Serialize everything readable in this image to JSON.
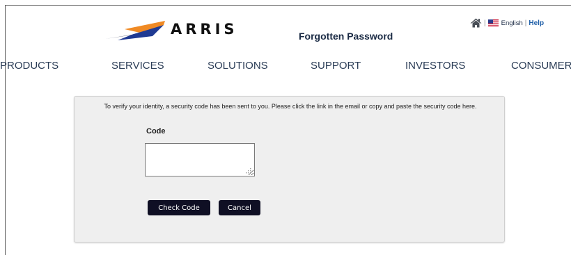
{
  "header": {
    "logo_text": "ARRIS",
    "page_title": "Forgotten Password",
    "language": "English",
    "separator": "|",
    "help_label": "Help"
  },
  "nav": {
    "items": [
      {
        "label": "PRODUCTS"
      },
      {
        "label": "SERVICES"
      },
      {
        "label": "SOLUTIONS"
      },
      {
        "label": "SUPPORT"
      },
      {
        "label": "INVESTORS"
      },
      {
        "label": "CONSUMERS"
      }
    ]
  },
  "form": {
    "instructions": "To verify your identity, a security code has been sent to you. Please click the link in the email or copy and paste the security code here.",
    "code_label": "Code",
    "code_value": "",
    "check_code_label": "Check Code",
    "cancel_label": "Cancel"
  },
  "icons": {
    "home": "home-icon",
    "flag": "us-flag-icon",
    "logo_swoosh": "arris-swoosh-icon"
  },
  "colors": {
    "button_bg": "#0f0f24",
    "link_help": "#1f5fa8",
    "nav_text": "#2a3c56",
    "panel_bg": "#efefef",
    "logo_orange": "#f08a24",
    "logo_blue": "#1f3a93",
    "logo_navy": "#151b3f"
  }
}
